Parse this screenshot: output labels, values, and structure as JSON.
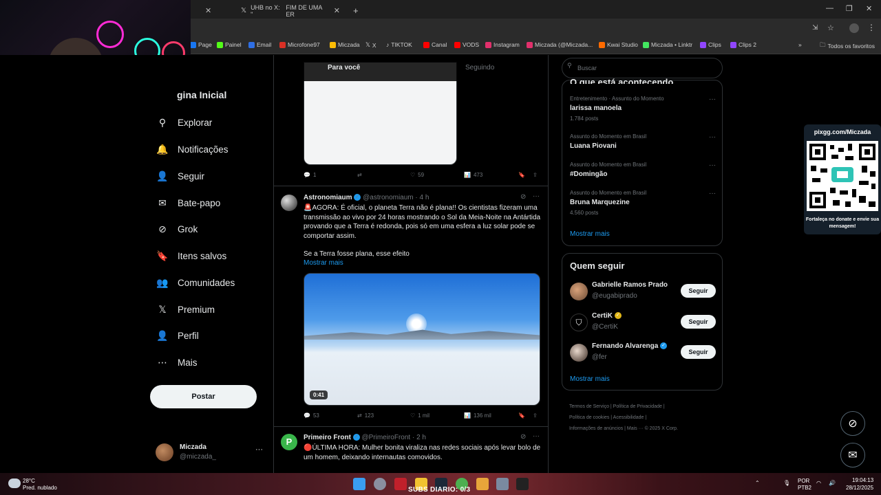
{
  "browser": {
    "tabs": [
      {
        "title": "UHB no X: \"",
        "sub": "FIM DE UMA ER"
      }
    ],
    "bookmarks": [
      {
        "label": "Page",
        "color": "#1877f2"
      },
      {
        "label": "Painel",
        "color": "#53fc18"
      },
      {
        "label": "Email",
        "color": "#2f6fe4"
      },
      {
        "label": "Microfone97",
        "color": "#d93025"
      },
      {
        "label": "Miczada",
        "color": "#fbbc05"
      },
      {
        "label": "X",
        "color": "#ffffff"
      },
      {
        "label": "TIKTOK",
        "color": "#ffffff"
      },
      {
        "label": "Canal",
        "color": "#ff0000"
      },
      {
        "label": "VODS",
        "color": "#ff0000"
      },
      {
        "label": "Instagram",
        "color": "#e1306c"
      },
      {
        "label": "Miczada (@Miczada...",
        "color": "#e1306c"
      },
      {
        "label": "Kwai Studio",
        "color": "#ff6b00"
      },
      {
        "label": "Miczada • Linktr",
        "color": "#43e660"
      },
      {
        "label": "Clips",
        "color": "#9146ff"
      },
      {
        "label": "Clips 2",
        "color": "#9146ff"
      }
    ],
    "all_favorites": "Todos os favoritos"
  },
  "nav": {
    "title": "gina Inicial",
    "items": [
      {
        "label": "Explorar",
        "icon": "search-icon",
        "glyph": "⚲"
      },
      {
        "label": "Notificações",
        "icon": "bell-icon",
        "glyph": "🔔"
      },
      {
        "label": "Seguir",
        "icon": "follow-icon",
        "glyph": "👤"
      },
      {
        "label": "Bate-papo",
        "icon": "mail-icon",
        "glyph": "✉"
      },
      {
        "label": "Grok",
        "icon": "grok-icon",
        "glyph": "⊘"
      },
      {
        "label": "Itens salvos",
        "icon": "bookmark-icon",
        "glyph": "🔖"
      },
      {
        "label": "Comunidades",
        "icon": "communities-icon",
        "glyph": "👥"
      },
      {
        "label": "Premium",
        "icon": "x-logo-icon",
        "glyph": "𝕏"
      },
      {
        "label": "Perfil",
        "icon": "profile-icon",
        "glyph": "👤"
      },
      {
        "label": "Mais",
        "icon": "more-icon",
        "glyph": "⋯"
      }
    ],
    "post_label": "Postar",
    "user": {
      "name": "Miczada",
      "handle": "@miczada_"
    }
  },
  "feed": {
    "tabs": [
      "Para você",
      "Seguindo"
    ],
    "prev_actions": {
      "replies": "1",
      "retweets": "",
      "likes": "59",
      "views": "473"
    },
    "tweet1": {
      "name": "Astronomiaum",
      "meta": "@astronomiaum · 4 h",
      "text": "🚨AGORA: É oficial, o planeta Terra não é plana!! Os cientistas fizeram uma transmissão ao vivo por 24 horas mostrando o Sol da Meia-Noite na Antártida provando que a Terra é redonda, pois só em uma esfera a luz solar pode se comportar assim.",
      "text2": "Se a Terra fosse plana, esse efeito",
      "more": "Mostrar mais",
      "duration": "0:41",
      "replies": "53",
      "retweets": "123",
      "likes": "1 mil",
      "views": "136 mil"
    },
    "tweet2": {
      "name": "Primeiro Front",
      "meta": "@PrimeiroFront · 2 h",
      "text": "🔴ÚLTIMA HORA: Mulher bonita viraliza nas redes sociais após levar bolo de um homem, deixando internautas comovidos."
    }
  },
  "right": {
    "search_placeholder": "Buscar",
    "trends_title": "O que está acontecendo",
    "trends": [
      {
        "cat": "Entretenimento · Assunto do Momento",
        "name": "larissa manoela",
        "count": "1.784 posts"
      },
      {
        "cat": "Assunto do Momento em Brasil",
        "name": "Luana Piovani",
        "count": ""
      },
      {
        "cat": "Assunto do Momento em Brasil",
        "name": "#Domingão",
        "count": ""
      },
      {
        "cat": "Assunto do Momento em Brasil",
        "name": "Bruna Marquezine",
        "count": "4.560 posts"
      }
    ],
    "show_more": "Mostrar mais",
    "who_title": "Quem seguir",
    "follows": [
      {
        "name": "Gabrielle Ramos Prado",
        "handle": "@eugabiprado",
        "btn": "Seguir"
      },
      {
        "name": "CertiK",
        "handle": "@CertiK",
        "btn": "Seguir"
      },
      {
        "name": "Fernando Alvarenga",
        "handle": "@fer",
        "btn": "Seguir"
      }
    ],
    "footer": {
      "l1": "Termos de Serviço  |  Política de Privacidade  |",
      "l2": "Política de cookies  |  Acessibilidade  |",
      "l3": "Informações de anúncios  |  Mais ···  © 2025 X Corp."
    }
  },
  "overlay": {
    "pix_title": "pixgg.com/Miczada",
    "pix_foot": "Fortaleça no donate e envie sua mensagem!"
  },
  "taskbar": {
    "temp": "28°C",
    "weather": "Pred. nublado",
    "counter": "SUBS DIARIO: 0/3",
    "lang1": "POR",
    "lang2": "PTB2",
    "time": "19:04:13",
    "date": "28/12/2025"
  }
}
